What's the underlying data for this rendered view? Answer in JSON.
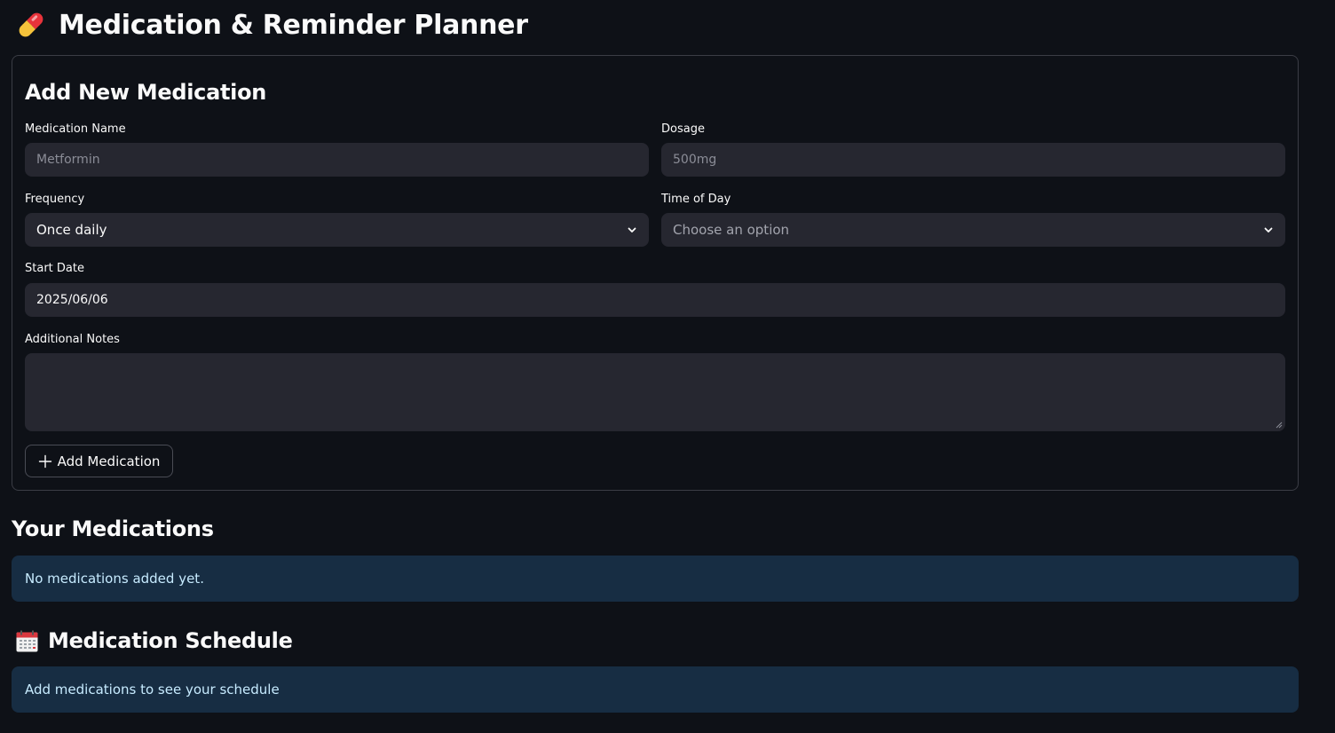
{
  "app": {
    "title": "Medication & Reminder Planner",
    "title_icon": "pill-icon"
  },
  "form": {
    "title": "Add New Medication",
    "medication_name": {
      "label": "Medication Name",
      "placeholder": "Metformin",
      "value": ""
    },
    "dosage": {
      "label": "Dosage",
      "placeholder": "500mg",
      "value": ""
    },
    "frequency": {
      "label": "Frequency",
      "selected": "Once daily"
    },
    "time_of_day": {
      "label": "Time of Day",
      "placeholder": "Choose an option"
    },
    "start_date": {
      "label": "Start Date",
      "value": "2025/06/06"
    },
    "notes": {
      "label": "Additional Notes",
      "value": ""
    },
    "add_button": {
      "label": "Add Medication",
      "icon": "plus-icon"
    }
  },
  "medications": {
    "title": "Your Medications",
    "empty_message": "No medications added yet."
  },
  "schedule": {
    "title": "Medication Schedule",
    "title_icon": "calendar-icon",
    "empty_message": "Add medications to see your schedule"
  },
  "colors": {
    "background": "#0e1117",
    "input_bg": "#262730",
    "info_bg": "#172d43",
    "info_text": "#c7ebff"
  }
}
